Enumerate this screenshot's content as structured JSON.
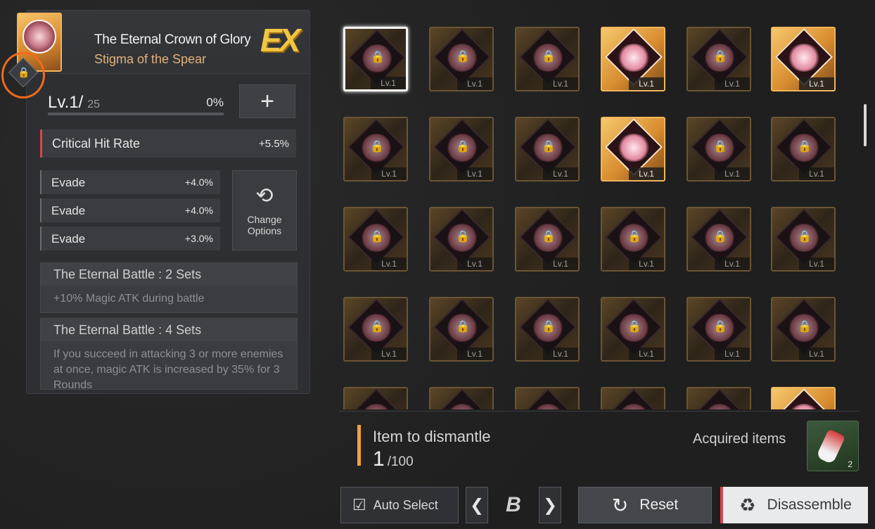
{
  "detail": {
    "name": "The Eternal Crown of Glory",
    "subtitle": "Stigma of the Spear",
    "grade": "EX",
    "level_prefix": "Lv.",
    "level": "1/",
    "level_max": "25",
    "level_percent": "0%",
    "plus_label": "+",
    "main_stat": {
      "label": "Critical Hit Rate",
      "value": "+5.5%"
    },
    "sub_stats": [
      {
        "label": "Evade",
        "value": "+4.0%"
      },
      {
        "label": "Evade",
        "value": "+4.0%"
      },
      {
        "label": "Evade",
        "value": "+3.0%"
      }
    ],
    "change_options": {
      "line1": "Change",
      "line2": "Options"
    },
    "sets": [
      {
        "title": "The Eternal Battle : 2 Sets",
        "desc": "+10% Magic ATK during battle"
      },
      {
        "title": "The Eternal Battle : 4 Sets",
        "desc": "If you succeed in attacking 3 or more enemies at once, magic ATK is increased by 35% for 3 Rounds"
      }
    ]
  },
  "grid": {
    "card_level": "Lv.1",
    "rows": [
      [
        "selected",
        "locked",
        "locked",
        "bright",
        "locked",
        "bright"
      ],
      [
        "locked",
        "locked",
        "locked",
        "bright",
        "locked",
        "locked"
      ],
      [
        "locked",
        "locked",
        "locked",
        "locked",
        "locked",
        "locked"
      ],
      [
        "locked",
        "locked",
        "locked",
        "locked",
        "locked",
        "locked"
      ],
      [
        "locked",
        "locked",
        "locked",
        "locked",
        "locked",
        "bright"
      ]
    ]
  },
  "bottom": {
    "dismantle_label": "Item to dismantle",
    "dismantle_count": "1",
    "dismantle_max": "/100",
    "acquired_label": "Acquired items",
    "acquired_count": "2",
    "auto_select": "Auto Select",
    "tier": "B",
    "reset": "Reset",
    "disassemble": "Disassemble"
  },
  "colors": {
    "accent_orange": "#f0a33d",
    "accent_red": "#d2474c",
    "gold": "#f2b55b"
  }
}
